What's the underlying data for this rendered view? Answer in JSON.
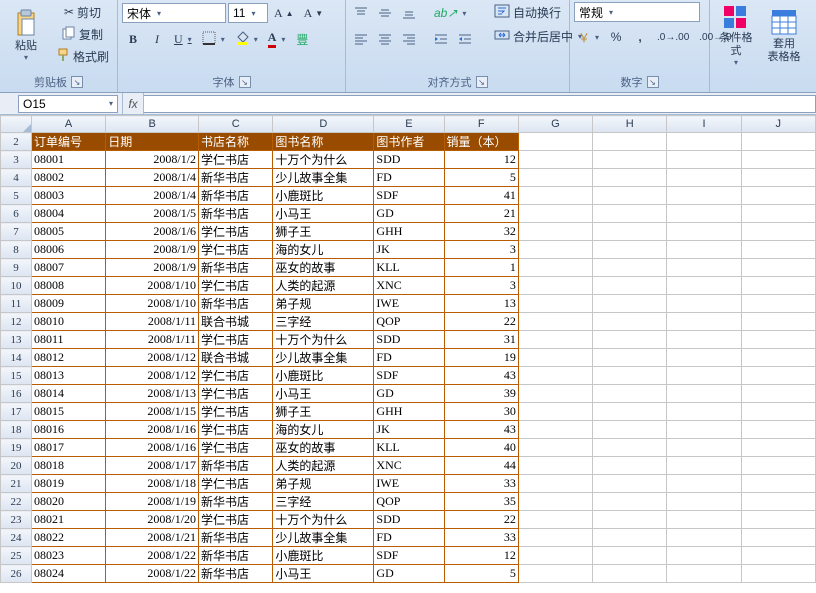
{
  "ribbon": {
    "clipboard": {
      "label": "剪贴板",
      "paste": "粘贴",
      "cut": "剪切",
      "copy": "复制",
      "format_painter": "格式刷"
    },
    "font": {
      "label": "字体",
      "name": "宋体",
      "size": "11",
      "bold": "B",
      "italic": "I",
      "underline": "U"
    },
    "alignment": {
      "label": "对齐方式",
      "wrap": "自动换行",
      "merge": "合并后居中"
    },
    "number": {
      "label": "数字",
      "format": "常规"
    },
    "styles": {
      "cond": "条件格式",
      "table": "套用\n表格格"
    }
  },
  "namebox": "O15",
  "columns": [
    "A",
    "B",
    "C",
    "D",
    "E",
    "F",
    "G",
    "H",
    "I",
    "J"
  ],
  "header_row": 2,
  "headers": [
    "订单编号",
    "日期",
    "书店名称",
    "图书名称",
    "图书作者",
    "销量（本）"
  ],
  "rows": [
    {
      "n": 3,
      "d": [
        "08001",
        "2008/1/2",
        "学仁书店",
        "十万个为什么",
        "SDD",
        "12"
      ]
    },
    {
      "n": 4,
      "d": [
        "08002",
        "2008/1/4",
        "新华书店",
        "少儿故事全集",
        "FD",
        "5"
      ]
    },
    {
      "n": 5,
      "d": [
        "08003",
        "2008/1/4",
        "新华书店",
        "小鹿斑比",
        "SDF",
        "41"
      ]
    },
    {
      "n": 6,
      "d": [
        "08004",
        "2008/1/5",
        "新华书店",
        "小马王",
        "GD",
        "21"
      ]
    },
    {
      "n": 7,
      "d": [
        "08005",
        "2008/1/6",
        "学仁书店",
        "狮子王",
        "GHH",
        "32"
      ]
    },
    {
      "n": 8,
      "d": [
        "08006",
        "2008/1/9",
        "学仁书店",
        "海的女儿",
        "JK",
        "3"
      ]
    },
    {
      "n": 9,
      "d": [
        "08007",
        "2008/1/9",
        "新华书店",
        "巫女的故事",
        "KLL",
        "1"
      ]
    },
    {
      "n": 10,
      "d": [
        "08008",
        "2008/1/10",
        "学仁书店",
        "人类的起源",
        "XNC",
        "3"
      ]
    },
    {
      "n": 11,
      "d": [
        "08009",
        "2008/1/10",
        "新华书店",
        "弟子规",
        "IWE",
        "13"
      ]
    },
    {
      "n": 12,
      "d": [
        "08010",
        "2008/1/11",
        "联合书城",
        "三字经",
        "QOP",
        "22"
      ]
    },
    {
      "n": 13,
      "d": [
        "08011",
        "2008/1/11",
        "学仁书店",
        "十万个为什么",
        "SDD",
        "31"
      ]
    },
    {
      "n": 14,
      "d": [
        "08012",
        "2008/1/12",
        "联合书城",
        "少儿故事全集",
        "FD",
        "19"
      ]
    },
    {
      "n": 15,
      "d": [
        "08013",
        "2008/1/12",
        "学仁书店",
        "小鹿斑比",
        "SDF",
        "43"
      ]
    },
    {
      "n": 16,
      "d": [
        "08014",
        "2008/1/13",
        "学仁书店",
        "小马王",
        "GD",
        "39"
      ]
    },
    {
      "n": 17,
      "d": [
        "08015",
        "2008/1/15",
        "学仁书店",
        "狮子王",
        "GHH",
        "30"
      ]
    },
    {
      "n": 18,
      "d": [
        "08016",
        "2008/1/16",
        "学仁书店",
        "海的女儿",
        "JK",
        "43"
      ]
    },
    {
      "n": 19,
      "d": [
        "08017",
        "2008/1/16",
        "学仁书店",
        "巫女的故事",
        "KLL",
        "40"
      ]
    },
    {
      "n": 20,
      "d": [
        "08018",
        "2008/1/17",
        "新华书店",
        "人类的起源",
        "XNC",
        "44"
      ]
    },
    {
      "n": 21,
      "d": [
        "08019",
        "2008/1/18",
        "学仁书店",
        "弟子规",
        "IWE",
        "33"
      ]
    },
    {
      "n": 22,
      "d": [
        "08020",
        "2008/1/19",
        "新华书店",
        "三字经",
        "QOP",
        "35"
      ]
    },
    {
      "n": 23,
      "d": [
        "08021",
        "2008/1/20",
        "学仁书店",
        "十万个为什么",
        "SDD",
        "22"
      ]
    },
    {
      "n": 24,
      "d": [
        "08022",
        "2008/1/21",
        "新华书店",
        "少儿故事全集",
        "FD",
        "33"
      ]
    },
    {
      "n": 25,
      "d": [
        "08023",
        "2008/1/22",
        "新华书店",
        "小鹿斑比",
        "SDF",
        "12"
      ]
    },
    {
      "n": 26,
      "d": [
        "08024",
        "2008/1/22",
        "新华书店",
        "小马王",
        "GD",
        "5"
      ]
    }
  ],
  "numeric_cols": [
    1,
    5
  ]
}
